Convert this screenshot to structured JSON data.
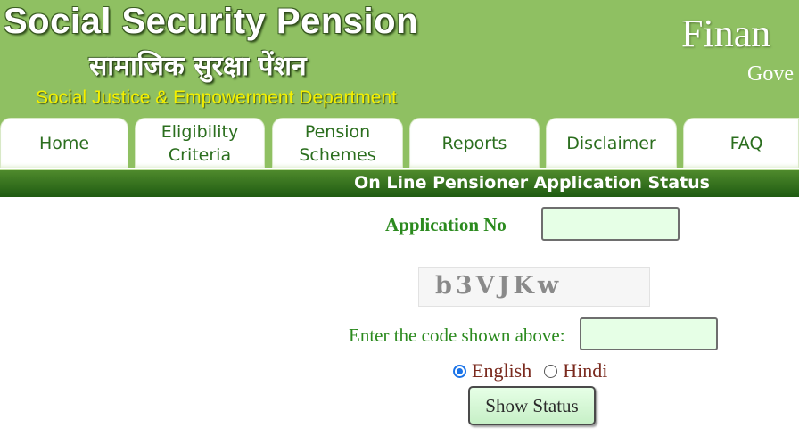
{
  "header": {
    "title_en": "Social Security Pension",
    "title_hi": "सामाजिक सुरक्षा पेंशन",
    "department": "Social Justice & Empowerment Department",
    "right_title": "Finan",
    "right_subtitle": "Gove"
  },
  "nav": {
    "tabs": [
      {
        "line1": "Home",
        "line2": ""
      },
      {
        "line1": "Eligibility",
        "line2": "Criteria"
      },
      {
        "line1": "Pension",
        "line2": "Schemes"
      },
      {
        "line1": "Reports",
        "line2": ""
      },
      {
        "line1": "Disclaimer",
        "line2": ""
      },
      {
        "line1": "FAQ",
        "line2": ""
      }
    ]
  },
  "status_bar": {
    "title": "On Line Pensioner Application Status"
  },
  "form": {
    "application_no_label": "Application No",
    "application_no_value": "",
    "captcha_text": "b3VJKw",
    "code_label": "Enter the code shown above:",
    "code_value": "",
    "language_options": [
      "English",
      "Hindi"
    ],
    "language_selected": "English",
    "submit_label": "Show Status"
  },
  "colors": {
    "header_green": "#8fc062",
    "bar_green": "#1f5b12",
    "label_green": "#2b8a1e",
    "input_bg": "#e6ffe6",
    "dept_yellow": "#f4f000"
  }
}
